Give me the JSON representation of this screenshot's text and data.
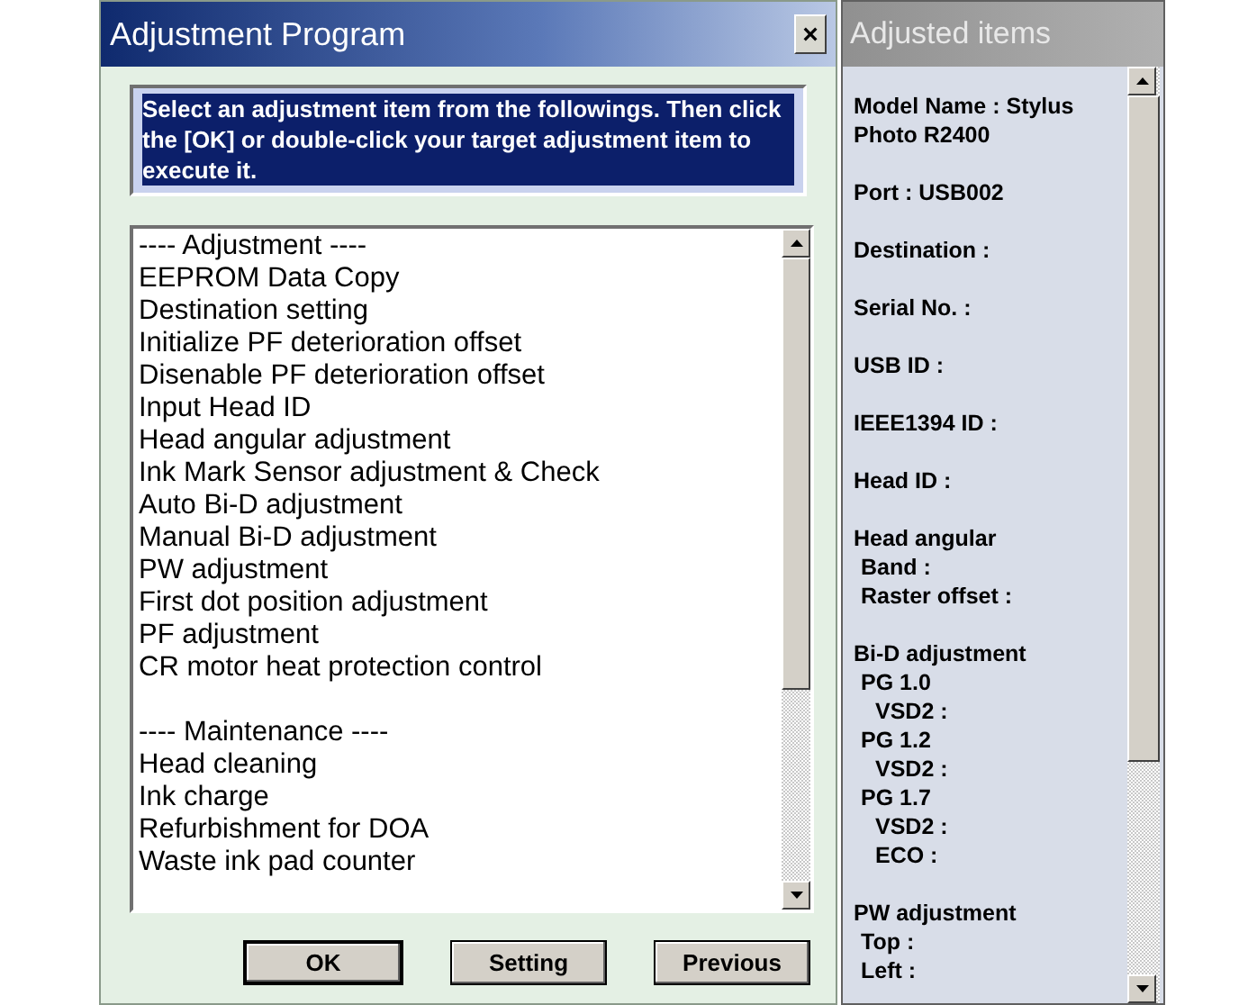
{
  "window": {
    "title": "Adjustment Program",
    "close": "×"
  },
  "instruction": "Select an adjustment item from the followings. Then click the [OK] or double-click your target adjustment item to execute it.",
  "list": {
    "sections": [
      {
        "header": "---- Adjustment ----",
        "items": [
          {
            "label": "EEPROM Data Copy",
            "selected": false
          },
          {
            "label": "Destination setting",
            "selected": false
          },
          {
            "label": "Initialize PF deterioration offset",
            "selected": false
          },
          {
            "label": "Disenable PF deterioration offset",
            "selected": false
          },
          {
            "label": "Input Head ID",
            "selected": false
          },
          {
            "label": "Head angular adjustment",
            "selected": false
          },
          {
            "label": "Ink Mark Sensor adjustment & Check",
            "selected": false
          },
          {
            "label": "Auto Bi-D adjustment",
            "selected": false
          },
          {
            "label": "Manual Bi-D adjustment",
            "selected": false
          },
          {
            "label": "PW adjustment",
            "selected": false
          },
          {
            "label": "First dot position adjustment",
            "selected": false
          },
          {
            "label": "PF adjustment",
            "selected": false
          },
          {
            "label": "CR motor heat protection control",
            "selected": false
          }
        ]
      },
      {
        "header": "---- Maintenance ----",
        "items": [
          {
            "label": "Head cleaning",
            "selected": false
          },
          {
            "label": "Ink charge",
            "selected": false
          },
          {
            "label": "Refurbishment for DOA",
            "selected": false
          },
          {
            "label": "Waste ink pad counter",
            "selected": false
          }
        ]
      }
    ]
  },
  "buttons": [
    "OK",
    "Setting",
    "Previous"
  ],
  "side_panel": {
    "title": "Adjusted items",
    "items": [
      {
        "label": "Model Name : Stylus Photo R2400"
      },
      {
        "label": "Port : USB002"
      },
      {
        "label": "Destination :"
      },
      {
        "label": "Serial No. :"
      },
      {
        "label": "USB ID :"
      },
      {
        "label": "IEEE1394 ID :"
      },
      {
        "label": "Head ID :"
      },
      {
        "label": "Head angular",
        "children": [
          {
            "label": "Band :"
          },
          {
            "label": "Raster offset :"
          }
        ]
      },
      {
        "label": "Bi-D adjustment",
        "children": [
          {
            "label": "PG 1.0",
            "children": [
              {
                "label": "VSD2 :"
              }
            ]
          },
          {
            "label": "PG 1.2",
            "children": [
              {
                "label": "VSD2 :"
              }
            ]
          },
          {
            "label": "PG 1.7",
            "children": [
              {
                "label": "VSD2 :"
              },
              {
                "label": "ECO :"
              }
            ]
          }
        ]
      },
      {
        "label": "PW adjustment",
        "children": [
          {
            "label": "Top :"
          },
          {
            "label": "Left :"
          }
        ]
      }
    ]
  }
}
